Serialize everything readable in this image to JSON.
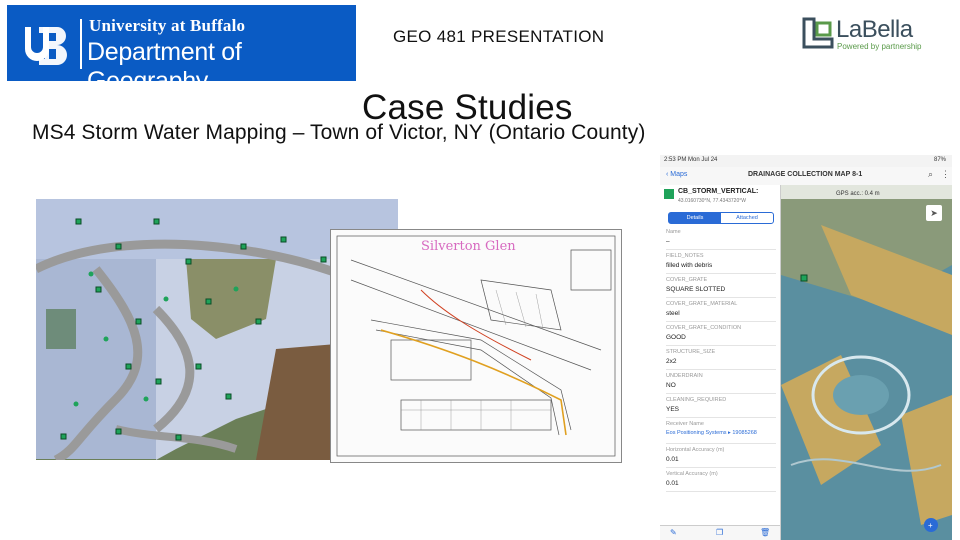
{
  "header": {
    "ub_logo": {
      "line1": "University at Buffalo",
      "line2": "Department of Geography"
    },
    "presentation_title": "GEO 481 PRESENTATION",
    "labella_logo": {
      "name": "LaBella",
      "tagline": "Powered by partnership"
    }
  },
  "slide": {
    "title": "Case Studies",
    "subtitle": "MS4 Storm Water Mapping – Town of Victor, NY (Ontario County)"
  },
  "tablet": {
    "status_time": "2:53 PM  Mon Jul 24",
    "status_battery": "87%",
    "back_label": "Maps",
    "header_title": "DRAINAGE COLLECTION MAP 8-1",
    "feature_name": "CB_STORM_VERTICAL:",
    "feature_coords": "43.0160730°N, 77.4343720°W",
    "tabs": [
      "Details",
      "Attached"
    ],
    "accuracy_banner": "GPS acc.: 0.4 m",
    "fields": [
      {
        "label": "Name",
        "value": "–"
      },
      {
        "label": "FIELD_NOTES",
        "value": "filled with debris"
      },
      {
        "label": "COVER_GRATE",
        "value": "SQUARE SLOTTED"
      },
      {
        "label": "COVER_GRATE_MATERIAL",
        "value": "steel"
      },
      {
        "label": "COVER_GRATE_CONDITION",
        "value": "GOOD"
      },
      {
        "label": "STRUCTURE_SIZE",
        "value": "2x2"
      },
      {
        "label": "UNDERDRAIN",
        "value": "NO"
      },
      {
        "label": "CLEANING_REQUIRED",
        "value": "YES"
      },
      {
        "label": "Receiver Name",
        "value": "Eos Positioning Systems ▸ 19085268"
      },
      {
        "label": "Horizontal Accuracy (m)",
        "value": "0.01"
      },
      {
        "label": "Vertical Accuracy (m)",
        "value": "0.01"
      }
    ]
  },
  "plan": {
    "handwriting": "Silverton Glen"
  },
  "colors": {
    "ub_blue": "#0a5bc4",
    "labella_green": "#5a9a4a",
    "labella_slate": "#3b4f5d"
  }
}
